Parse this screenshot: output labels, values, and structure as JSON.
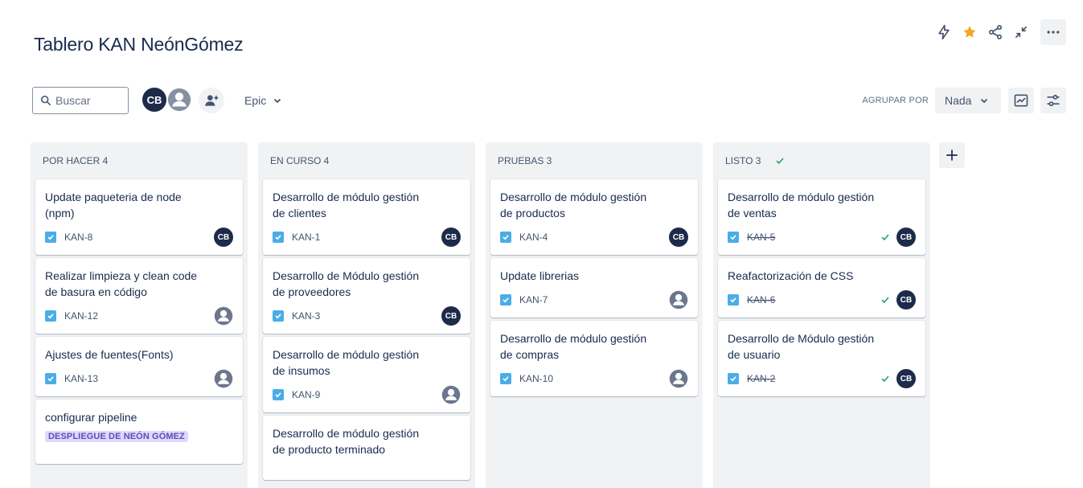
{
  "board": {
    "title": "Tablero KAN NeónGómez"
  },
  "top_actions": [
    {
      "name": "automation-icon"
    },
    {
      "name": "star-icon",
      "color": "#f5a623"
    },
    {
      "name": "share-icon"
    },
    {
      "name": "collapse-icon"
    },
    {
      "name": "more-icon"
    }
  ],
  "toolbar": {
    "search_placeholder": "Buscar",
    "avatar_initials": "CB",
    "epic_label": "Epic",
    "group_by_label": "AGRUPAR POR",
    "group_by_value": "Nada"
  },
  "columns": [
    {
      "header": "POR HACER 4",
      "cards": [
        {
          "title": "Update paqueteria de node (npm)",
          "key": "KAN-8",
          "assignee": "CB",
          "done": false
        },
        {
          "title": "Realizar limpieza y clean code de basura en código",
          "key": "KAN-12",
          "assignee": "",
          "done": false
        },
        {
          "title": "Ajustes de fuentes(Fonts)",
          "key": "KAN-13",
          "assignee": "",
          "done": false
        },
        {
          "title": "configurar pipeline",
          "epic": "DESPLIEGUE DE NEÓN GÓMEZ"
        }
      ]
    },
    {
      "header": "EN CURSO 4",
      "cards": [
        {
          "title": "Desarrollo de módulo gestión de clientes",
          "key": "KAN-1",
          "assignee": "CB",
          "done": false
        },
        {
          "title": "Desarrollo de Módulo gestión de proveedores",
          "key": "KAN-3",
          "assignee": "CB",
          "done": false
        },
        {
          "title": "Desarrollo de módulo gestión de insumos",
          "key": "KAN-9",
          "assignee": "",
          "done": false
        },
        {
          "title": "Desarrollo de módulo gestión de producto terminado"
        }
      ]
    },
    {
      "header": "PRUEBAS 3",
      "cards": [
        {
          "title": "Desarrollo de módulo gestión de productos",
          "key": "KAN-4",
          "assignee": "CB",
          "done": false
        },
        {
          "title": "Update librerias",
          "key": "KAN-7",
          "assignee": "",
          "done": false
        },
        {
          "title": "Desarrollo de módulo gestión de compras",
          "key": "KAN-10",
          "assignee": "",
          "done": false
        }
      ]
    },
    {
      "header": "LISTO 3",
      "cards": [
        {
          "title": "Desarrollo de módulo gestión de ventas",
          "key": "KAN-5",
          "assignee": "CB",
          "done": true
        },
        {
          "title": "Reafactorización de CSS",
          "key": "KAN-6",
          "assignee": "CB",
          "done": true
        },
        {
          "title": "Desarrollo de Módulo gestión de usuario",
          "key": "KAN-2",
          "assignee": "CB",
          "done": true
        }
      ]
    }
  ],
  "colors": {
    "task_icon": "#4bade8",
    "avatar_bg": "#1d2b4b",
    "done_check": "#22a06b",
    "epic_bg": "#dfd8fd",
    "epic_text": "#5e4db2"
  }
}
